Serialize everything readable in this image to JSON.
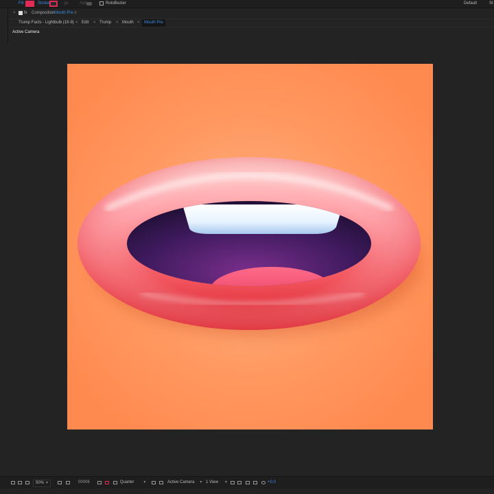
{
  "toolbar": {
    "fill_label": "Fill",
    "fill_color": "#e12a55",
    "stroke_label": "Stroke",
    "stroke_color": "#e12a55",
    "px_label": "- px",
    "add_label": "Add",
    "rotobezier_label": "RotoBezier",
    "workspace_label": "Default",
    "workspace_more": "St"
  },
  "composition": {
    "prefix": "Composition",
    "name": "Mouth Pre",
    "icons": [
      "close-icon",
      "lock-icon",
      "fx-icon",
      "menu-icon"
    ]
  },
  "breadcrumb": {
    "items": [
      "Trump Facts - Lightbulb (16-9)",
      "Edit",
      "Trump",
      "Mouth"
    ],
    "active": "Mouth Pre"
  },
  "viewer": {
    "label": "Active Camera",
    "background_color": "#ff8a50"
  },
  "bottombar": {
    "zoom": "50%",
    "timecode": "00006",
    "resolution": "Quarter",
    "camera": "Active Camera",
    "views": "1 View",
    "exposure": "+0.0",
    "icons": [
      "always-preview-icon",
      "mask-icon",
      "region-icon",
      "snapshot-icon",
      "color-icon",
      "transparency-icon",
      "3d-view-icon",
      "views-icon",
      "flowchart-icon",
      "reset-exposure-icon"
    ]
  }
}
